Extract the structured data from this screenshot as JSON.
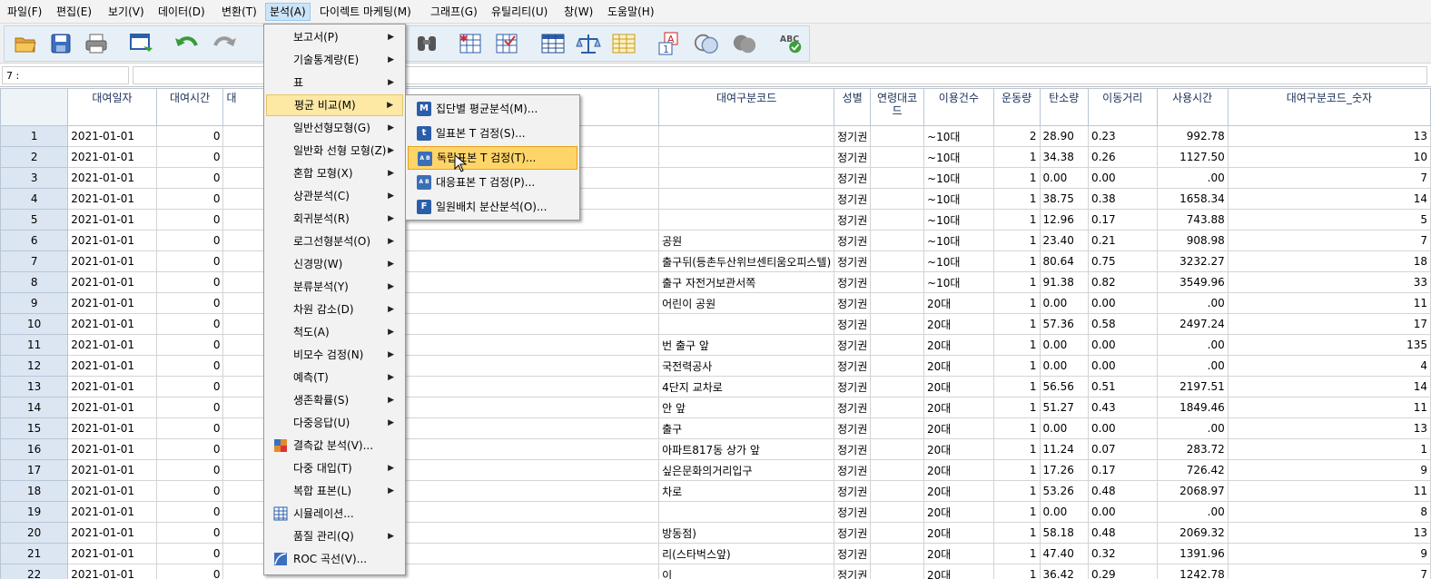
{
  "menubar": [
    {
      "label": "파일(F)",
      "name": "menu-file"
    },
    {
      "label": "편집(E)",
      "name": "menu-edit"
    },
    {
      "label": "보기(V)",
      "name": "menu-view"
    },
    {
      "label": "데이터(D)",
      "name": "menu-data"
    },
    {
      "label": "변환(T)",
      "name": "menu-transform"
    },
    {
      "label": "분석(A)",
      "name": "menu-analyze"
    },
    {
      "label": "다이렉트 마케팅(M)",
      "name": "menu-direct-marketing"
    },
    {
      "label": "그래프(G)",
      "name": "menu-graphs"
    },
    {
      "label": "유틸리티(U)",
      "name": "menu-utilities"
    },
    {
      "label": "창(W)",
      "name": "menu-window"
    },
    {
      "label": "도움말(H)",
      "name": "menu-help"
    }
  ],
  "refbar": {
    "cell": "7 :",
    "value": ""
  },
  "columns": [
    "대여일자",
    "대여시간",
    "대",
    "대여구분코드",
    "성별",
    "연령대코드",
    "이용건수",
    "운동량",
    "탄소량",
    "이동거리",
    "사용시간",
    "대여구분코드_숫자"
  ],
  "rows": [
    {
      "n": "1",
      "date": "2021-01-01",
      "time": "0",
      "name": "",
      "type": "정기권",
      "age": "~10대",
      "count": "2",
      "exercise": "28.90",
      "carbon": "0.23",
      "dist": "992.78",
      "use": "13"
    },
    {
      "n": "2",
      "date": "2021-01-01",
      "time": "0",
      "name": "",
      "type": "정기권",
      "age": "~10대",
      "count": "1",
      "exercise": "34.38",
      "carbon": "0.26",
      "dist": "1127.50",
      "use": "10"
    },
    {
      "n": "3",
      "date": "2021-01-01",
      "time": "0",
      "name": "",
      "type": "정기권",
      "age": "~10대",
      "count": "1",
      "exercise": "0.00",
      "carbon": "0.00",
      "dist": ".00",
      "use": "7"
    },
    {
      "n": "4",
      "date": "2021-01-01",
      "time": "0",
      "name": "",
      "type": "정기권",
      "age": "~10대",
      "count": "1",
      "exercise": "38.75",
      "carbon": "0.38",
      "dist": "1658.34",
      "use": "14"
    },
    {
      "n": "5",
      "date": "2021-01-01",
      "time": "0",
      "name": "",
      "type": "정기권",
      "age": "~10대",
      "count": "1",
      "exercise": "12.96",
      "carbon": "0.17",
      "dist": "743.88",
      "use": "5"
    },
    {
      "n": "6",
      "date": "2021-01-01",
      "time": "0",
      "name": "공원",
      "type": "정기권",
      "age": "~10대",
      "count": "1",
      "exercise": "23.40",
      "carbon": "0.21",
      "dist": "908.98",
      "use": "7"
    },
    {
      "n": "7",
      "date": "2021-01-01",
      "time": "0",
      "name": "출구뒤(등촌두산위브센티움오피스텔)",
      "type": "정기권",
      "age": "~10대",
      "count": "1",
      "exercise": "80.64",
      "carbon": "0.75",
      "dist": "3232.27",
      "use": "18"
    },
    {
      "n": "8",
      "date": "2021-01-01",
      "time": "0",
      "name": "출구 자전거보관서쪽",
      "type": "정기권",
      "age": "~10대",
      "count": "1",
      "exercise": "91.38",
      "carbon": "0.82",
      "dist": "3549.96",
      "use": "33"
    },
    {
      "n": "9",
      "date": "2021-01-01",
      "time": "0",
      "name": "어린이 공원",
      "type": "정기권",
      "age": "20대",
      "count": "1",
      "exercise": "0.00",
      "carbon": "0.00",
      "dist": ".00",
      "use": "11"
    },
    {
      "n": "10",
      "date": "2021-01-01",
      "time": "0",
      "name": "",
      "type": "정기권",
      "age": "20대",
      "count": "1",
      "exercise": "57.36",
      "carbon": "0.58",
      "dist": "2497.24",
      "use": "17"
    },
    {
      "n": "11",
      "date": "2021-01-01",
      "time": "0",
      "name": "번 출구 앞",
      "type": "정기권",
      "age": "20대",
      "count": "1",
      "exercise": "0.00",
      "carbon": "0.00",
      "dist": ".00",
      "use": "135"
    },
    {
      "n": "12",
      "date": "2021-01-01",
      "time": "0",
      "name": "국전력공사",
      "type": "정기권",
      "age": "20대",
      "count": "1",
      "exercise": "0.00",
      "carbon": "0.00",
      "dist": ".00",
      "use": "4"
    },
    {
      "n": "13",
      "date": "2021-01-01",
      "time": "0",
      "name": "4단지 교차로",
      "type": "정기권",
      "age": "20대",
      "count": "1",
      "exercise": "56.56",
      "carbon": "0.51",
      "dist": "2197.51",
      "use": "14"
    },
    {
      "n": "14",
      "date": "2021-01-01",
      "time": "0",
      "name": "안 앞",
      "type": "정기권",
      "age": "20대",
      "count": "1",
      "exercise": "51.27",
      "carbon": "0.43",
      "dist": "1849.46",
      "use": "11"
    },
    {
      "n": "15",
      "date": "2021-01-01",
      "time": "0",
      "name": "출구",
      "type": "정기권",
      "age": "20대",
      "count": "1",
      "exercise": "0.00",
      "carbon": "0.00",
      "dist": ".00",
      "use": "13"
    },
    {
      "n": "16",
      "date": "2021-01-01",
      "time": "0",
      "name": "아파트817동 상가 앞",
      "type": "정기권",
      "age": "20대",
      "count": "1",
      "exercise": "11.24",
      "carbon": "0.07",
      "dist": "283.72",
      "use": "1"
    },
    {
      "n": "17",
      "date": "2021-01-01",
      "time": "0",
      "name": "싶은문화의거리입구",
      "type": "정기권",
      "age": "20대",
      "count": "1",
      "exercise": "17.26",
      "carbon": "0.17",
      "dist": "726.42",
      "use": "9"
    },
    {
      "n": "18",
      "date": "2021-01-01",
      "time": "0",
      "name": "차로",
      "type": "정기권",
      "age": "20대",
      "count": "1",
      "exercise": "53.26",
      "carbon": "0.48",
      "dist": "2068.97",
      "use": "11"
    },
    {
      "n": "19",
      "date": "2021-01-01",
      "time": "0",
      "name": "",
      "type": "정기권",
      "age": "20대",
      "count": "1",
      "exercise": "0.00",
      "carbon": "0.00",
      "dist": ".00",
      "use": "8"
    },
    {
      "n": "20",
      "date": "2021-01-01",
      "time": "0",
      "name": "방동점)",
      "type": "정기권",
      "age": "20대",
      "count": "1",
      "exercise": "58.18",
      "carbon": "0.48",
      "dist": "2069.32",
      "use": "13"
    },
    {
      "n": "21",
      "date": "2021-01-01",
      "time": "0",
      "name": "리(스타벅스앞)",
      "type": "정기권",
      "age": "20대",
      "count": "1",
      "exercise": "47.40",
      "carbon": "0.32",
      "dist": "1391.96",
      "use": "9"
    },
    {
      "n": "22",
      "date": "2021-01-01",
      "time": "0",
      "name": "이",
      "type": "정기권",
      "age": "20대",
      "count": "1",
      "exercise": "36.42",
      "carbon": "0.29",
      "dist": "1242.78",
      "use": "7"
    }
  ],
  "analyze_menu": [
    {
      "label": "보고서(P)",
      "arrow": true,
      "name": "menu-item-reports"
    },
    {
      "label": "기술통계량(E)",
      "arrow": true,
      "name": "menu-item-descriptive-statistics"
    },
    {
      "label": "표",
      "arrow": true,
      "name": "menu-item-tables"
    },
    {
      "label": "평균 비교(M)",
      "arrow": true,
      "name": "menu-item-compare-means",
      "state": "hl2"
    },
    {
      "label": "일반선형모형(G)",
      "arrow": true,
      "name": "menu-item-general-linear-model"
    },
    {
      "label": "일반화 선형 모형(Z)",
      "arrow": true,
      "name": "menu-item-generalized-linear-models"
    },
    {
      "label": "혼합 모형(X)",
      "arrow": true,
      "name": "menu-item-mixed-models"
    },
    {
      "label": "상관분석(C)",
      "arrow": true,
      "name": "menu-item-correlate"
    },
    {
      "label": "회귀분석(R)",
      "arrow": true,
      "name": "menu-item-regression"
    },
    {
      "label": "로그선형분석(O)",
      "arrow": true,
      "name": "menu-item-loglinear"
    },
    {
      "label": "신경망(W)",
      "arrow": true,
      "name": "menu-item-neural-networks"
    },
    {
      "label": "분류분석(Y)",
      "arrow": true,
      "name": "menu-item-classify"
    },
    {
      "label": "차원 감소(D)",
      "arrow": true,
      "name": "menu-item-dimension-reduction"
    },
    {
      "label": "척도(A)",
      "arrow": true,
      "name": "menu-item-scale"
    },
    {
      "label": "비모수 검정(N)",
      "arrow": true,
      "name": "menu-item-nonparametric-tests"
    },
    {
      "label": "예측(T)",
      "arrow": true,
      "name": "menu-item-forecasting"
    },
    {
      "label": "생존확률(S)",
      "arrow": true,
      "name": "menu-item-survival"
    },
    {
      "label": "다중응답(U)",
      "arrow": true,
      "name": "menu-item-multiple-response"
    },
    {
      "label": "결측값 분석(V)...",
      "arrow": false,
      "icon": "missing-value-icon",
      "name": "menu-item-missing-value-analysis"
    },
    {
      "label": "다중 대입(T)",
      "arrow": true,
      "name": "menu-item-multiple-imputation"
    },
    {
      "label": "복합 표본(L)",
      "arrow": true,
      "name": "menu-item-complex-samples"
    },
    {
      "label": "시뮬레이션...",
      "arrow": false,
      "icon": "simulation-icon",
      "name": "menu-item-simulation"
    },
    {
      "label": "품질 관리(Q)",
      "arrow": true,
      "name": "menu-item-quality-control"
    },
    {
      "label": "ROC 곡선(V)...",
      "arrow": false,
      "icon": "roc-curve-icon",
      "name": "menu-item-roc-curve"
    }
  ],
  "compare_menu": [
    {
      "label": "집단별 평균분석(M)...",
      "icon_text": "M",
      "icon_color": "#2b5ea8",
      "name": "submenu-item-means"
    },
    {
      "label": "일표본 T 검정(S)...",
      "icon_text": "t",
      "icon_color": "#2b5ea8",
      "name": "submenu-item-one-sample-t-test"
    },
    {
      "label": "독립표본 T 검정(T)...",
      "icon_text": "A B",
      "icon_color": "#3a6fb7",
      "name": "submenu-item-independent-samples-t-test",
      "state": "hl"
    },
    {
      "label": "대응표본 T 검정(P)...",
      "icon_text": "A B",
      "icon_color": "#3a6fb7",
      "name": "submenu-item-paired-samples-t-test"
    },
    {
      "label": "일원배치 분산분석(O)...",
      "icon_text": "F",
      "icon_color": "#2b5ea8",
      "name": "submenu-item-one-way-anova"
    }
  ],
  "toolbar_icons": [
    "open-icon",
    "save-icon",
    "print-icon",
    "dialog-recall-icon",
    "undo-icon",
    "redo-icon",
    "find-icon",
    "insert-cases-icon",
    "insert-variable-icon",
    "split-file-icon",
    "weight-cases-icon",
    "select-cases-icon",
    "value-labels-icon",
    "use-sets-icon",
    "show-all-icon",
    "spelling-icon"
  ],
  "colors": {
    "highlight": "#ffd15c",
    "row_header": "#dce6f2",
    "header_text": "#1a2f5a"
  }
}
